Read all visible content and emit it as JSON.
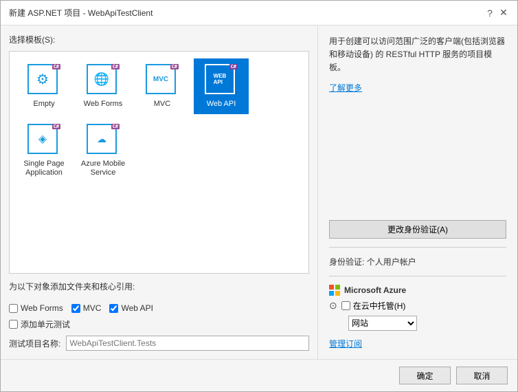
{
  "dialog": {
    "title": "新建 ASP.NET 项目 - WebApiTestClient",
    "help_btn": "?",
    "close_btn": "✕"
  },
  "left": {
    "template_label": "选择模板(S):",
    "templates": [
      {
        "id": "empty",
        "label": "Empty",
        "selected": false,
        "icon_type": "gear"
      },
      {
        "id": "webforms",
        "label": "Web Forms",
        "selected": false,
        "icon_type": "globe"
      },
      {
        "id": "mvc",
        "label": "MVC",
        "selected": false,
        "icon_type": "mvc"
      },
      {
        "id": "webapi",
        "label": "Web API",
        "selected": true,
        "icon_type": "api"
      },
      {
        "id": "spa",
        "label": "Single Page Application",
        "selected": false,
        "icon_type": "spa"
      },
      {
        "id": "azure",
        "label": "Azure Mobile Service",
        "selected": false,
        "icon_type": "azure"
      }
    ],
    "folders_label": "为以下对象添加文件夹和核心引用:",
    "checkboxes": [
      {
        "id": "webforms_cb",
        "label": "Web Forms",
        "checked": false
      },
      {
        "id": "mvc_cb",
        "label": "MVC",
        "checked": true
      },
      {
        "id": "webapi_cb",
        "label": "Web API",
        "checked": true
      }
    ],
    "unit_test_label": "添加单元测试",
    "unit_test_checked": false,
    "test_project_label": "测试项目名称:",
    "test_project_placeholder": "WebApiTestClient.Tests"
  },
  "right": {
    "description": "用于创建可以访问范围广泛的客户端(包括浏览器和移动设备) 的 RESTful HTTP 服务的项目模板。",
    "learn_more": "了解更多",
    "auth_btn_label": "更改身份验证(A)",
    "auth_label": "身份验证:",
    "auth_value": "个人用户帐户",
    "azure_title": "Microsoft Azure",
    "host_label": "在云中托管(H)",
    "host_checked": false,
    "dropdown_value": "网站",
    "manage_link": "管理订阅"
  },
  "footer": {
    "ok_label": "确定",
    "cancel_label": "取消"
  }
}
